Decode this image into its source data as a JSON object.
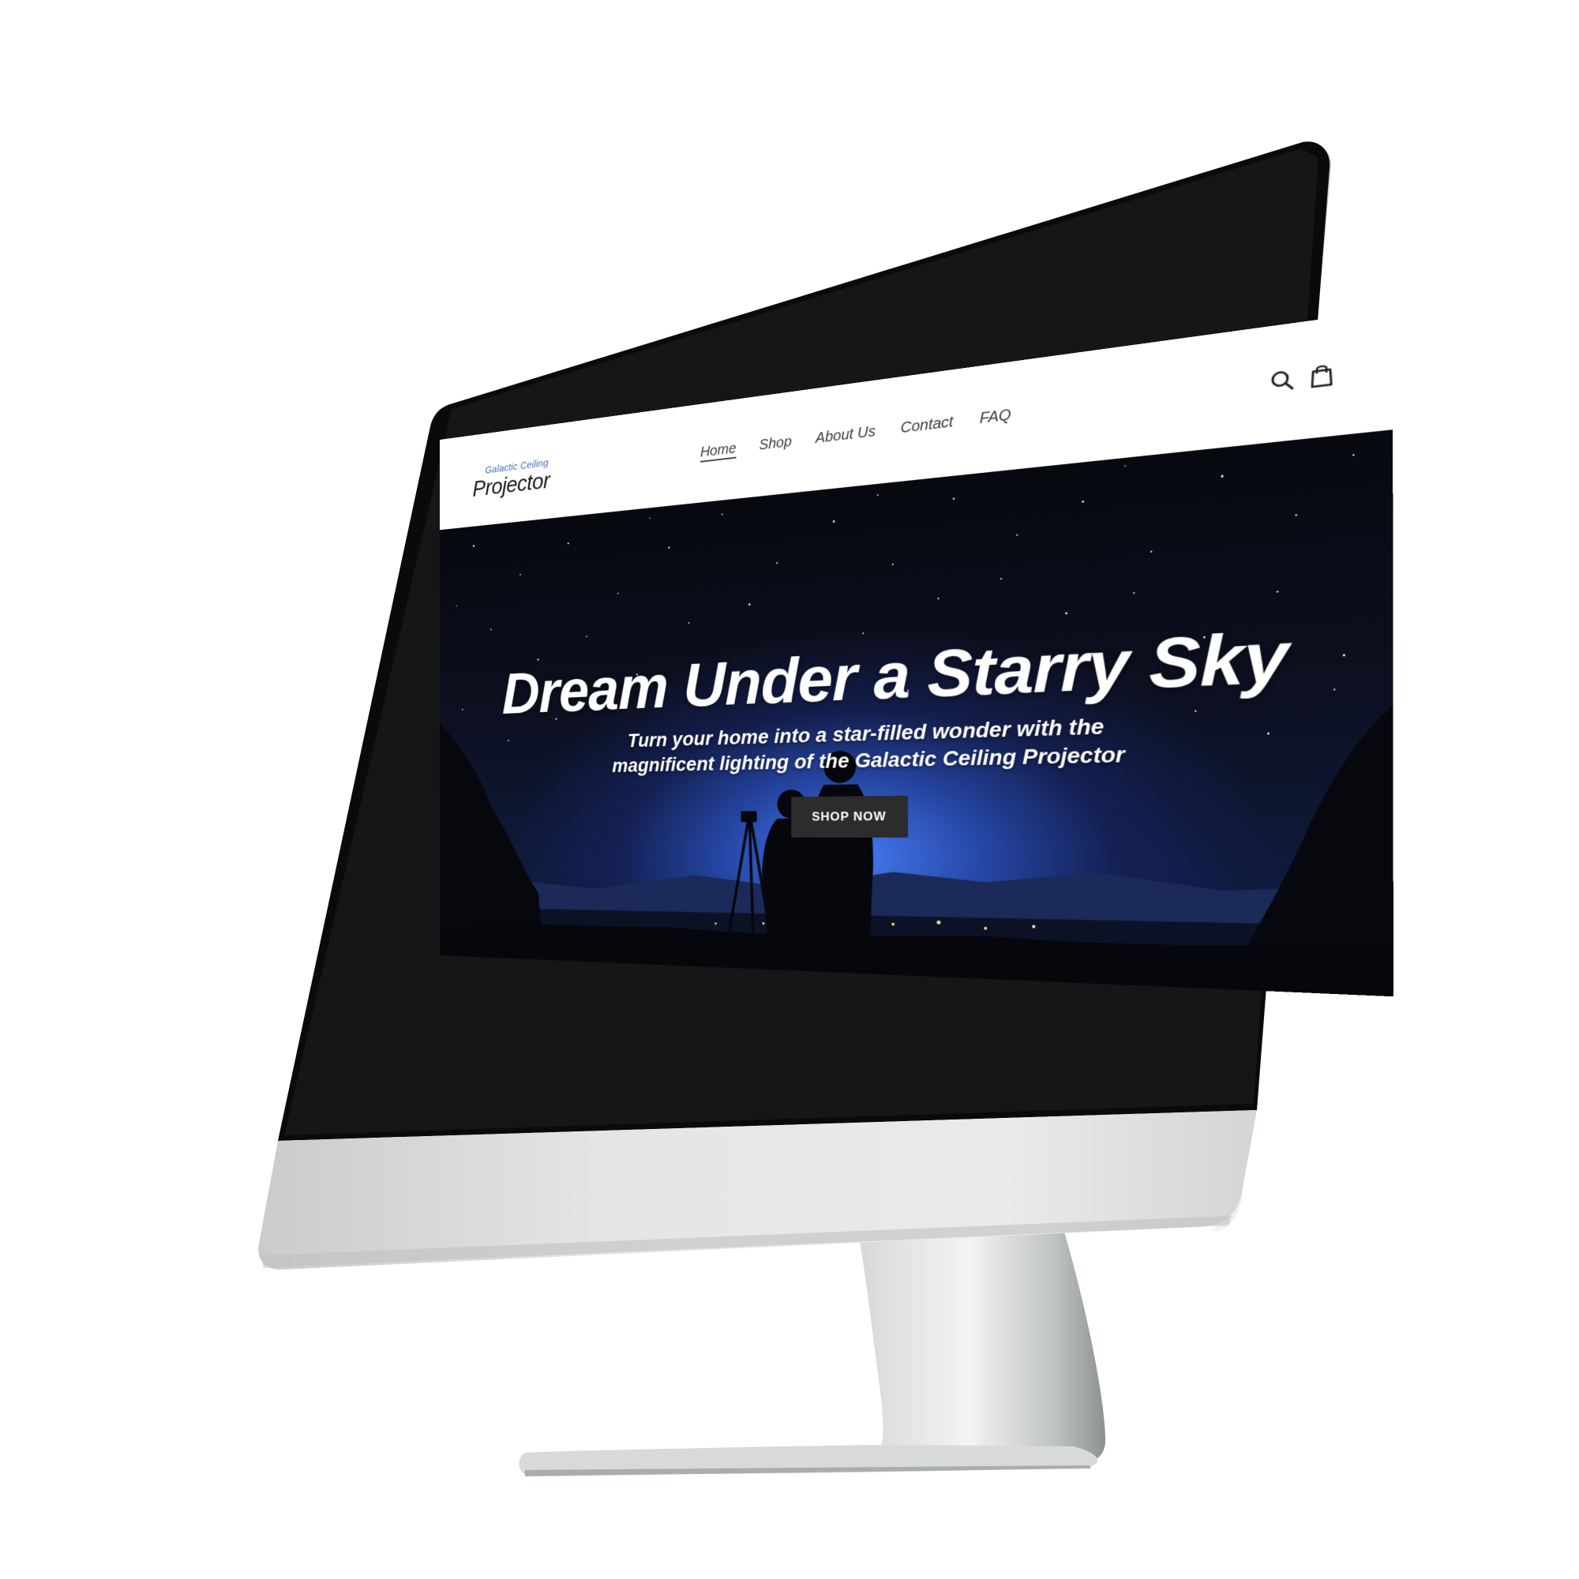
{
  "site": {
    "logo": {
      "top_line": "Galactic Ceiling",
      "main": "Projector"
    },
    "nav": [
      {
        "label": "Home",
        "active": true
      },
      {
        "label": "Shop",
        "active": false
      },
      {
        "label": "About Us",
        "active": false
      },
      {
        "label": "Contact",
        "active": false
      },
      {
        "label": "FAQ",
        "active": false
      }
    ],
    "icons": [
      "search-icon",
      "cart-icon"
    ]
  },
  "hero": {
    "title": "Dream Under a Starry Sky",
    "subtitle": "Turn your home into a star-filled wonder with the magnificent lighting of the Galactic Ceiling Projector",
    "cta_label": "SHOP NOW"
  },
  "colors": {
    "header_bg": "#ffffff",
    "nav_text": "#3a3a3a",
    "logo_accent": "#3a6fc4",
    "button_bg": "#2c2c2c",
    "hero_glow": "#4b82ff"
  }
}
